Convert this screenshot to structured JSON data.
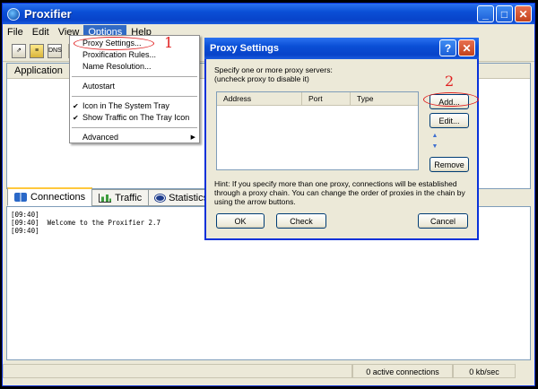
{
  "window": {
    "title": "Proxifier",
    "min_icon": "minimize-icon",
    "max_icon": "maximize-icon",
    "close_icon": "close-icon"
  },
  "menubar": {
    "items": [
      "File",
      "Edit",
      "View",
      "Options",
      "Help"
    ],
    "active": "Options"
  },
  "main": {
    "column_application": "Application"
  },
  "tabs": [
    {
      "label": "Connections",
      "icon": "connections-icon",
      "active": true
    },
    {
      "label": "Traffic",
      "icon": "traffic-chart-icon",
      "active": false
    },
    {
      "label": "Statistics",
      "icon": "statistics-icon",
      "active": false
    }
  ],
  "log": {
    "lines": [
      "[09:40]",
      "[09:40]  Welcome to the Proxifier 2.7",
      "[09:40]"
    ]
  },
  "status": {
    "connections": "0 active connections",
    "speed": "0 kb/sec"
  },
  "options_menu": {
    "items": [
      {
        "label": "Proxy Settings...",
        "checked": false
      },
      {
        "label": "Proxification Rules...",
        "checked": false
      },
      {
        "label": "Name Resolution...",
        "checked": false
      },
      {
        "label": "Autostart",
        "checked": false
      },
      {
        "label": "Icon in The System Tray",
        "checked": true
      },
      {
        "label": "Show Traffic on The Tray Icon",
        "checked": true
      },
      {
        "label": "Advanced",
        "checked": false,
        "submenu": true
      }
    ]
  },
  "annotations": {
    "first": "1",
    "second": "2",
    "color": "#e02020"
  },
  "proxy_dialog": {
    "title": "Proxy Settings",
    "help_icon": "help-icon",
    "close_icon": "close-icon",
    "instructions_line1": "Specify one or more proxy servers:",
    "instructions_line2": "(uncheck proxy to disable it)",
    "columns": [
      "Address",
      "Port",
      "Type"
    ],
    "buttons": {
      "add": "Add...",
      "edit": "Edit...",
      "remove": "Remove",
      "ok": "OK",
      "check": "Check",
      "cancel": "Cancel"
    },
    "hint_line1": "Hint: If you specify more than one proxy, connections will be established",
    "hint_line2": "through a proxy chain. You can change the order of proxies in the chain by",
    "hint_line3": "using the arrow buttons."
  },
  "colors": {
    "titlebar": "#0a4fd6",
    "menu_highlight": "#316ac5",
    "face": "#ece9d8"
  }
}
